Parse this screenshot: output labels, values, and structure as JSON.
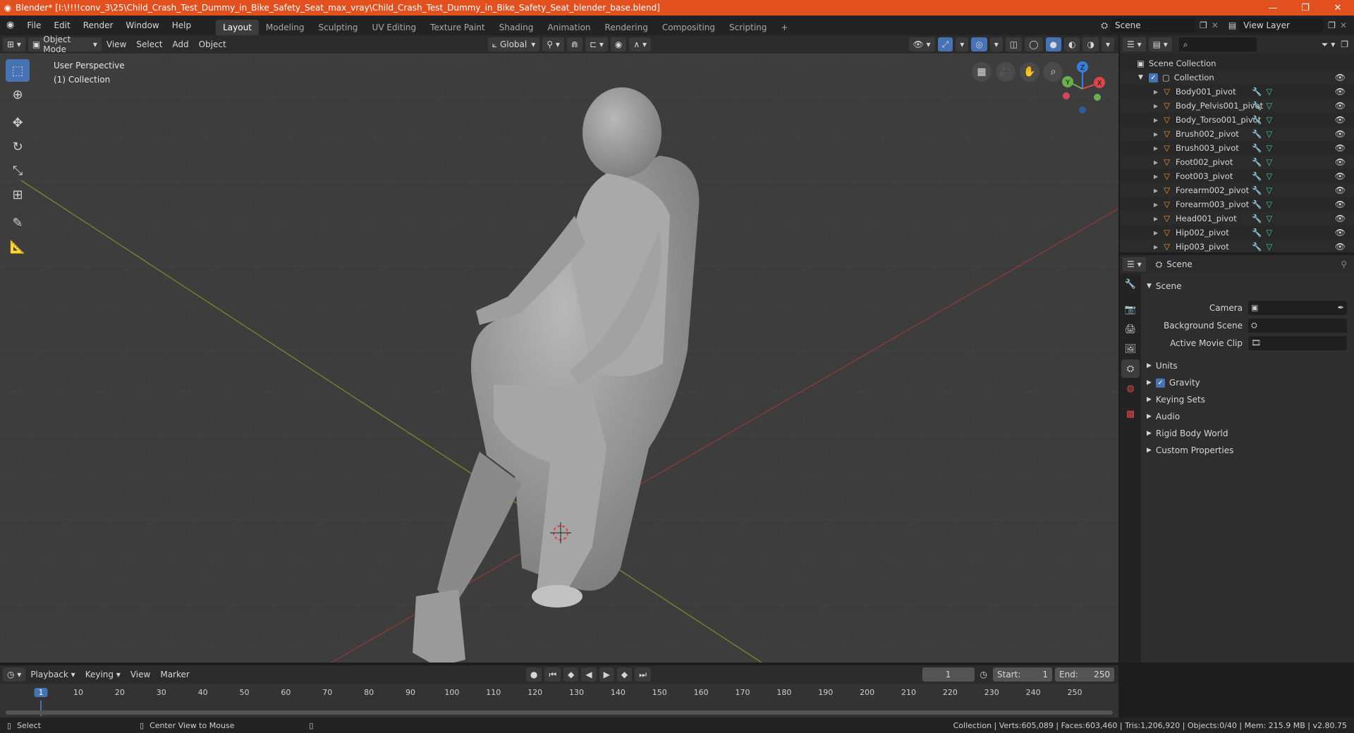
{
  "window": {
    "title": "Blender* [I:\\!!!!conv_3\\25\\Child_Crash_Test_Dummy_in_Bike_Safety_Seat_max_vray\\Child_Crash_Test_Dummy_in_Bike_Safety_Seat_blender_base.blend]",
    "minimize": "—",
    "maximize": "❐",
    "close": "✕"
  },
  "menus": [
    "File",
    "Edit",
    "Render",
    "Window",
    "Help"
  ],
  "workspaces": [
    {
      "label": "Layout",
      "active": true
    },
    {
      "label": "Modeling"
    },
    {
      "label": "Sculpting"
    },
    {
      "label": "UV Editing"
    },
    {
      "label": "Texture Paint"
    },
    {
      "label": "Shading"
    },
    {
      "label": "Animation"
    },
    {
      "label": "Rendering"
    },
    {
      "label": "Compositing"
    },
    {
      "label": "Scripting"
    }
  ],
  "add_workspace": "+",
  "scene_selector": {
    "value": "Scene"
  },
  "view_layer_selector": {
    "value": "View Layer"
  },
  "viewport_header": {
    "mode": "Object Mode",
    "menus": [
      "View",
      "Select",
      "Add",
      "Object"
    ],
    "orientation": "Global"
  },
  "viewport": {
    "perspective_label": "User Perspective",
    "collection_label": "(1) Collection",
    "gizmo": {
      "x": "X",
      "y": "Y",
      "z": "Z"
    }
  },
  "outliner": {
    "search_placeholder": "",
    "scene_collection": "Scene Collection",
    "collection": "Collection",
    "items": [
      "Body001_pivot",
      "Body_Pelvis001_pivot",
      "Body_Torso001_pivot",
      "Brush002_pivot",
      "Brush003_pivot",
      "Foot002_pivot",
      "Foot003_pivot",
      "Forearm002_pivot",
      "Forearm003_pivot",
      "Head001_pivot",
      "Hip002_pivot",
      "Hip003_pivot"
    ]
  },
  "properties": {
    "header_title": "Scene",
    "panel_title": "Scene",
    "fields": [
      {
        "label": "Camera",
        "value": ""
      },
      {
        "label": "Background Scene",
        "value": ""
      },
      {
        "label": "Active Movie Clip",
        "value": ""
      }
    ],
    "panels": [
      {
        "label": "Units"
      },
      {
        "label": "Gravity",
        "checkbox": true
      },
      {
        "label": "Keying Sets"
      },
      {
        "label": "Audio"
      },
      {
        "label": "Rigid Body World"
      },
      {
        "label": "Custom Properties"
      }
    ]
  },
  "timeline": {
    "menus": [
      "Playback",
      "Keying",
      "View",
      "Marker"
    ],
    "current_frame": "1",
    "start_label": "Start:",
    "start": "1",
    "end_label": "End:",
    "end": "250",
    "ticks": [
      "1",
      "10",
      "20",
      "30",
      "40",
      "50",
      "60",
      "70",
      "80",
      "90",
      "100",
      "110",
      "120",
      "130",
      "140",
      "150",
      "160",
      "170",
      "180",
      "190",
      "200",
      "210",
      "220",
      "230",
      "240",
      "250"
    ]
  },
  "statusbar": {
    "left_action": "Select",
    "middle_action": "Center View to Mouse",
    "stats": "Collection | Verts:605,089 | Faces:603,460 | Tris:1,206,920 | Objects:0/40 | Mem: 215.9 MB | v2.80.75"
  },
  "colors": {
    "titlebar": "#e1501e",
    "accent": "#4772b3",
    "viewport_bg": "#3d3d3d",
    "x_axis": "#8b3a3a",
    "y_axis": "#6b8a2a"
  }
}
